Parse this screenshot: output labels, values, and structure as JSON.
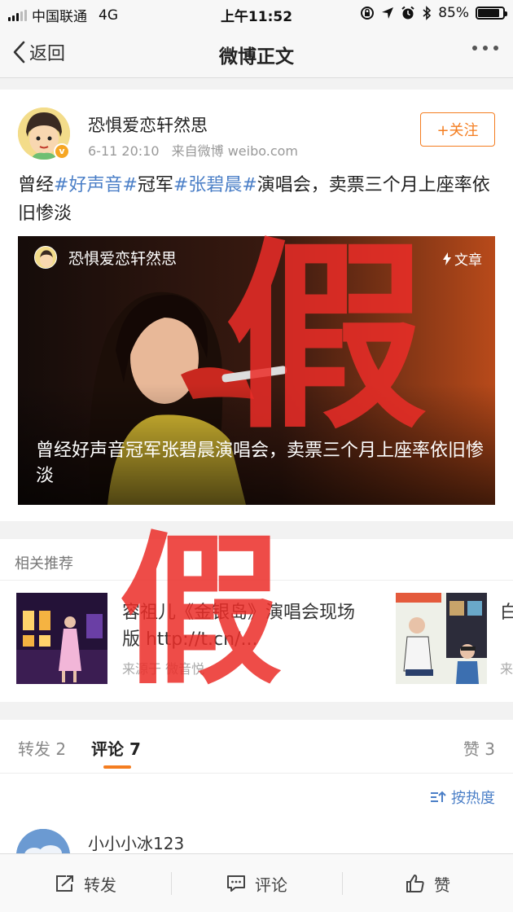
{
  "status_bar": {
    "carrier": "中国联通",
    "network": "4G",
    "time": "上午11:52",
    "battery": "85%",
    "battery_level": 0.85
  },
  "nav": {
    "back_label": "返回",
    "title": "微博正文"
  },
  "post": {
    "username": "恐惧爱恋轩然思",
    "timestamp": "6-11 20:10",
    "source": "来自微博 weibo.com",
    "follow_label": "+关注",
    "text": {
      "part1": "曾经",
      "tag1": "#好声音#",
      "part2": "冠军",
      "tag2": "#张碧晨#",
      "part3": "演唱会，卖票三个月上座率依旧惨淡"
    },
    "article": {
      "username": "恐惧爱恋轩然思",
      "type_label": "文章",
      "title": "曾经好声音冠军张碧晨演唱会，卖票三个月上座率依旧惨淡"
    }
  },
  "watermark": "假",
  "related": {
    "title": "相关推荐",
    "items": [
      {
        "text": "容祖儿《金银岛》演唱会现场版 http://t.cn/...",
        "source": "来源于 微音悦"
      },
      {
        "text": "白",
        "source": "来"
      }
    ]
  },
  "tabs": {
    "repost": "转发 2",
    "comment": "评论 7",
    "like": "赞 3"
  },
  "comments": {
    "sort_label": "按热度",
    "items": [
      {
        "username": "小小小冰123"
      }
    ]
  },
  "bottom_bar": {
    "repost": "转发",
    "comment": "评论",
    "like": "赞"
  },
  "colors": {
    "accent": "#f47d20",
    "link": "#4b7fc7",
    "watermark": "#eb2d28"
  }
}
